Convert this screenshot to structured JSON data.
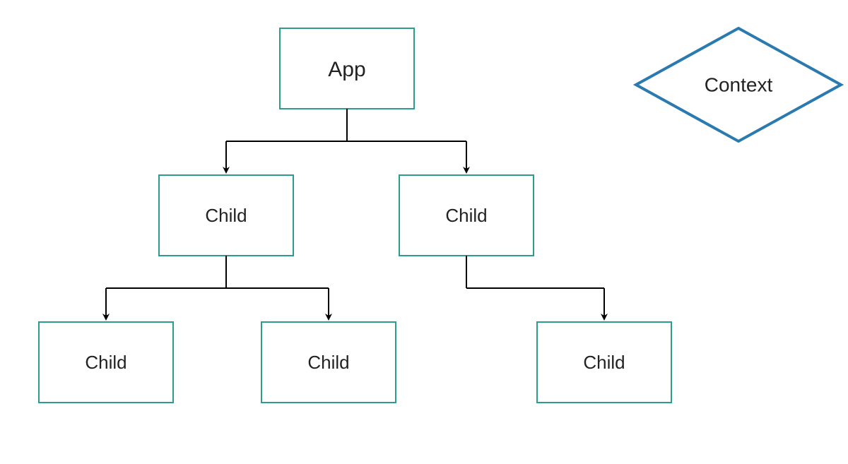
{
  "diagram": {
    "colors": {
      "node_border": "#2a9d8f",
      "diamond_border": "#2a7ab0",
      "connector": "#000000"
    },
    "nodes": {
      "app": "App",
      "child_l1_a": "Child",
      "child_l1_b": "Child",
      "child_l2_a": "Child",
      "child_l2_b": "Child",
      "child_l2_c": "Child",
      "context": "Context"
    }
  }
}
